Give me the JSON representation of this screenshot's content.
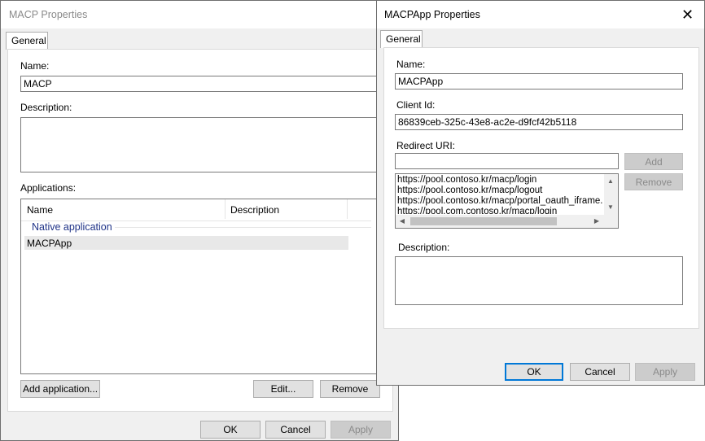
{
  "back_dialog": {
    "title": "MACP Properties",
    "tab": "General",
    "name_label": "Name:",
    "name_value": "MACP",
    "description_label": "Description:",
    "applications_label": "Applications:",
    "table_headers": [
      "Name",
      "Description"
    ],
    "group_label": "Native application",
    "rows": [
      {
        "name": "MACPApp",
        "description": ""
      }
    ],
    "add_application_label": "Add application...",
    "edit_label": "Edit...",
    "remove_label": "Remove",
    "ok_label": "OK",
    "cancel_label": "Cancel",
    "apply_label": "Apply"
  },
  "front_dialog": {
    "title": "MACPApp Properties",
    "tab": "General",
    "name_label": "Name:",
    "name_value": "MACPApp",
    "client_id_label": "Client Id:",
    "client_id_value": "86839ceb-325c-43e8-ac2e-d9fcf42b5118",
    "redirect_uri_label": "Redirect URI:",
    "redirect_uri_input": "",
    "add_label": "Add",
    "remove_label": "Remove",
    "redirect_uris": [
      "https://pool.contoso.kr/macp/login",
      "https://pool.contoso.kr/macp/logout",
      "https://pool.contoso.kr/macp/portal_oauth_iframe.htm",
      "https://pool.com.contoso.kr/macp/login"
    ],
    "description_label": "Description:",
    "ok_label": "OK",
    "cancel_label": "Cancel",
    "apply_label": "Apply",
    "close_glyph": "✕"
  },
  "icons": {
    "scroll_up": "▲",
    "scroll_down": "▼",
    "scroll_left": "◀",
    "scroll_right": "▶"
  }
}
